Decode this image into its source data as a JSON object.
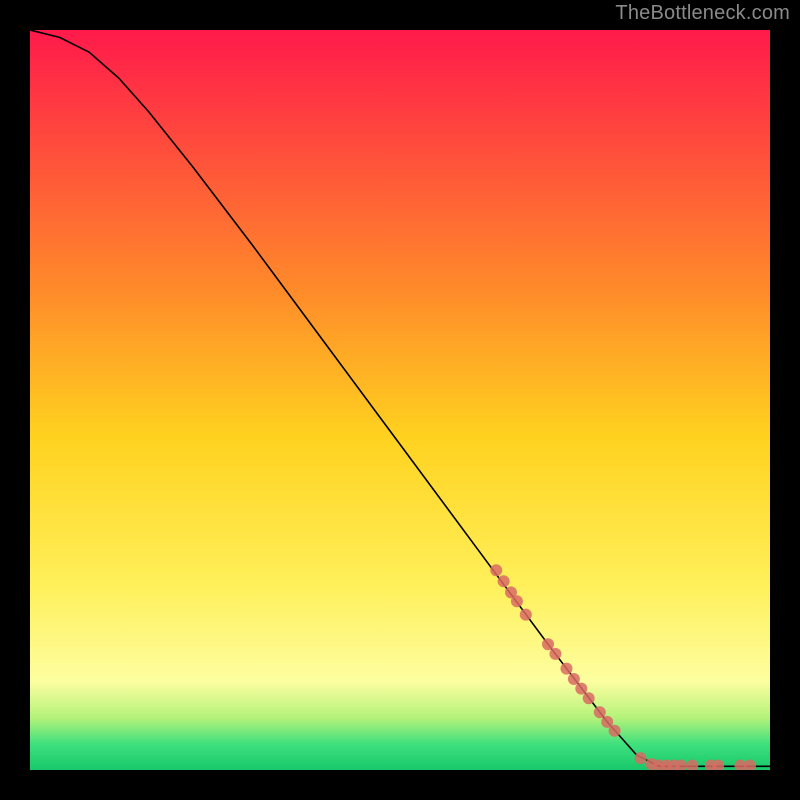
{
  "watermark": "TheBottleneck.com",
  "chart_data": {
    "type": "line",
    "title": "",
    "xlabel": "",
    "ylabel": "",
    "xlim": [
      0,
      100
    ],
    "ylim": [
      0,
      100
    ],
    "grid": false,
    "legend": false,
    "background_gradient": {
      "stops": [
        {
          "offset": 0.0,
          "color": "#ff1a4b"
        },
        {
          "offset": 0.35,
          "color": "#ff8a2a"
        },
        {
          "offset": 0.55,
          "color": "#ffd21f"
        },
        {
          "offset": 0.75,
          "color": "#fff05a"
        },
        {
          "offset": 0.88,
          "color": "#fdfea0"
        },
        {
          "offset": 0.93,
          "color": "#b3f27a"
        },
        {
          "offset": 0.965,
          "color": "#3fe07d"
        },
        {
          "offset": 1.0,
          "color": "#18c86a"
        }
      ]
    },
    "series": [
      {
        "name": "curve",
        "style": "line",
        "color": "#000000",
        "width": 1.6,
        "points": [
          {
            "x": 0,
            "y": 100
          },
          {
            "x": 4,
            "y": 99
          },
          {
            "x": 8,
            "y": 97
          },
          {
            "x": 12,
            "y": 93.5
          },
          {
            "x": 16,
            "y": 89
          },
          {
            "x": 22,
            "y": 81.5
          },
          {
            "x": 30,
            "y": 71
          },
          {
            "x": 40,
            "y": 57.5
          },
          {
            "x": 50,
            "y": 44
          },
          {
            "x": 60,
            "y": 30.5
          },
          {
            "x": 70,
            "y": 17
          },
          {
            "x": 78,
            "y": 6.5
          },
          {
            "x": 82,
            "y": 2
          },
          {
            "x": 85,
            "y": 0.5
          },
          {
            "x": 100,
            "y": 0.5
          }
        ]
      },
      {
        "name": "dots",
        "style": "points",
        "color": "#d96a63",
        "alpha": 0.85,
        "radius": 6,
        "points": [
          {
            "x": 63,
            "y": 27
          },
          {
            "x": 64,
            "y": 25.5
          },
          {
            "x": 65,
            "y": 24
          },
          {
            "x": 65.8,
            "y": 22.8
          },
          {
            "x": 67,
            "y": 21
          },
          {
            "x": 70,
            "y": 17
          },
          {
            "x": 71,
            "y": 15.7
          },
          {
            "x": 72.5,
            "y": 13.7
          },
          {
            "x": 73.5,
            "y": 12.3
          },
          {
            "x": 74.5,
            "y": 11
          },
          {
            "x": 75.5,
            "y": 9.7
          },
          {
            "x": 77,
            "y": 7.8
          },
          {
            "x": 78,
            "y": 6.5
          },
          {
            "x": 79,
            "y": 5.3
          },
          {
            "x": 82.5,
            "y": 1.6
          },
          {
            "x": 84,
            "y": 0.8
          },
          {
            "x": 85,
            "y": 0.6
          },
          {
            "x": 86,
            "y": 0.6
          },
          {
            "x": 87,
            "y": 0.6
          },
          {
            "x": 88,
            "y": 0.6
          },
          {
            "x": 89.5,
            "y": 0.6
          },
          {
            "x": 92,
            "y": 0.6
          },
          {
            "x": 93,
            "y": 0.6
          },
          {
            "x": 96,
            "y": 0.6
          },
          {
            "x": 97.3,
            "y": 0.6
          }
        ]
      }
    ]
  }
}
